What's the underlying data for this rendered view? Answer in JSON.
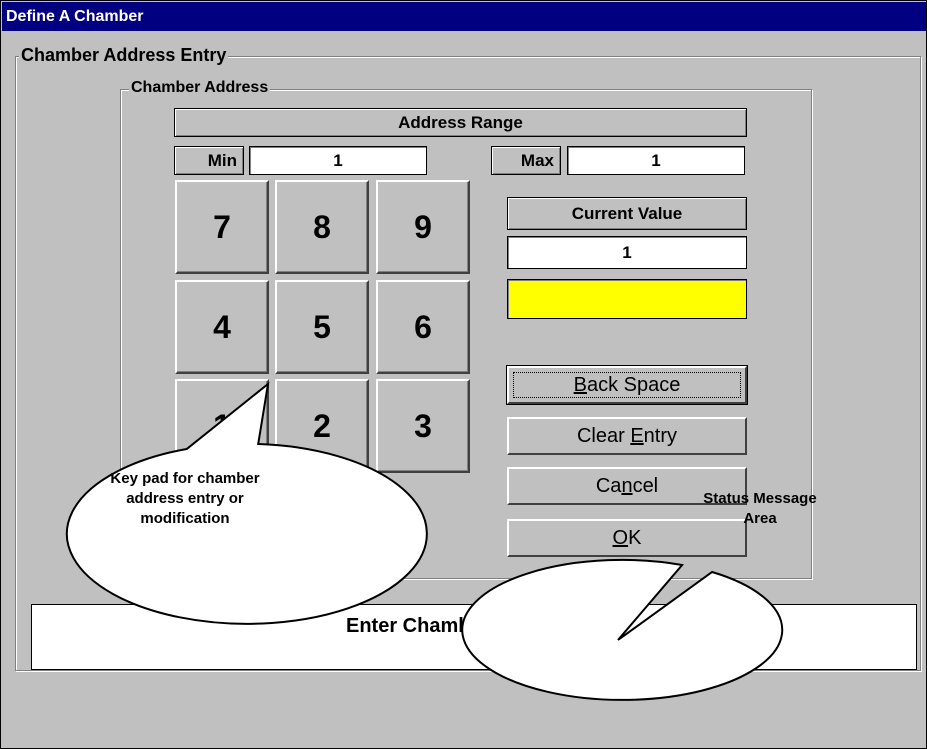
{
  "window": {
    "title": "Define A Chamber"
  },
  "entry_group": {
    "label": "Chamber Address Entry"
  },
  "address_group": {
    "label": "Chamber Address"
  },
  "range": {
    "header": "Address Range",
    "min_label": "Min",
    "min_value": "1",
    "max_label": "Max",
    "max_value": "1"
  },
  "keypad": {
    "k7": "7",
    "k8": "8",
    "k9": "9",
    "k4": "4",
    "k5": "5",
    "k6": "6",
    "k1": "1",
    "k2": "2",
    "k3": "3"
  },
  "current": {
    "label": "Current Value",
    "value": "1",
    "entry_value": "",
    "entry_color": "#ffff00"
  },
  "buttons": {
    "back_space": {
      "mnemonic": "B",
      "rest": "ack Space"
    },
    "clear_entry": {
      "pre": "Clear ",
      "mnemonic": "E",
      "rest": "ntry"
    },
    "cancel": {
      "pre": "Ca",
      "mnemonic": "n",
      "rest": "cel"
    },
    "ok": {
      "mnemonic": "O",
      "rest": "K"
    }
  },
  "status": {
    "message": "Enter Chamber Address ...."
  },
  "callouts": {
    "keypad": [
      "Key pad for chamber",
      "address entry or",
      "modification"
    ],
    "status": [
      "Status Message",
      "Area"
    ]
  }
}
